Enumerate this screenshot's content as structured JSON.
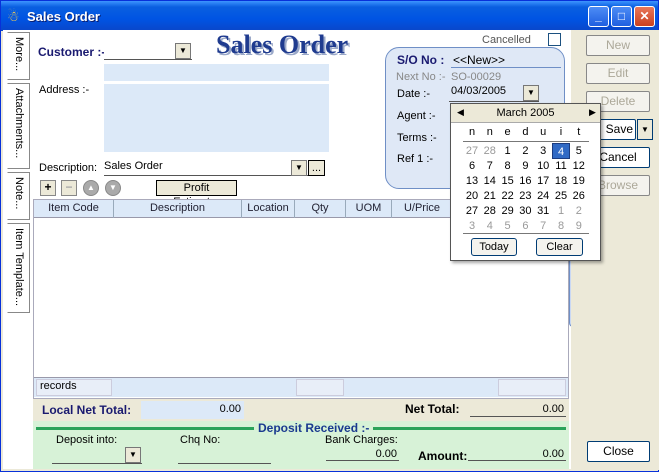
{
  "window": {
    "title": "Sales Order"
  },
  "side_tabs": [
    {
      "label": "More..."
    },
    {
      "label": "Attachments..."
    },
    {
      "label": "Note..."
    },
    {
      "label": "Item Template..."
    }
  ],
  "header": {
    "big_title": "Sales Order",
    "customer_label": "Customer :-",
    "customer_value": "",
    "address_label": "Address :-",
    "description_label": "Description:",
    "description_value": "Sales Order",
    "cancelled_label": "Cancelled"
  },
  "so_panel": {
    "so_no_label": "S/O No :",
    "so_no_value": "<<New>>",
    "next_no_label": "Next No :-",
    "next_no_value": "SO-00029",
    "date_label": "Date :-",
    "date_value": "04/03/2005",
    "agent_label": "Agent :-",
    "terms_label": "Terms :-",
    "ref_label": "Ref 1 :-"
  },
  "toolbar": {
    "add": "+",
    "remove": "−",
    "up": "▲",
    "down": "▼",
    "profit_estimator": "Profit Estimator",
    "ellipsis": "..."
  },
  "grid": {
    "columns": [
      "Item Code",
      "Description",
      "Location",
      "Qty",
      "UOM",
      "U/Price"
    ],
    "footer_label": "records"
  },
  "totals": {
    "local_net_total_label": "Local Net Total:",
    "local_net_total_value": "0.00",
    "net_total_label": "Net Total:",
    "net_total_value": "0.00"
  },
  "deposit": {
    "section_label": "Deposit Received :-",
    "deposit_into_label": "Deposit into:",
    "chq_no_label": "Chq No:",
    "bank_charges_label": "Bank Charges:",
    "bank_charges_value": "0.00",
    "amount_label": "Amount:",
    "amount_value": "0.00"
  },
  "side_buttons": {
    "new": "New",
    "edit": "Edit",
    "delete": "Delete",
    "save": "Save",
    "cancel": "Cancel",
    "browse": "Browse",
    "close": "Close"
  },
  "calendar": {
    "month": "March 2005",
    "day_headers": [
      "n",
      "n",
      "e",
      "d",
      "u",
      "i",
      "t"
    ],
    "weeks": [
      [
        "27",
        "28",
        "1",
        "2",
        "3",
        "4",
        "5"
      ],
      [
        "6",
        "7",
        "8",
        "9",
        "10",
        "11",
        "12"
      ],
      [
        "13",
        "14",
        "15",
        "16",
        "17",
        "18",
        "19"
      ],
      [
        "20",
        "21",
        "22",
        "23",
        "24",
        "25",
        "26"
      ],
      [
        "27",
        "28",
        "29",
        "30",
        "31",
        "1",
        "2"
      ],
      [
        "3",
        "4",
        "5",
        "6",
        "7",
        "8",
        "9"
      ]
    ],
    "selected_day": "4",
    "today_label": "Today",
    "clear_label": "Clear"
  },
  "colors": {
    "title_blue": "#1f3b8f",
    "field_bg": "#dce9f8",
    "deposit_bg": "#d7f2d7",
    "selected": "#316ac5"
  }
}
